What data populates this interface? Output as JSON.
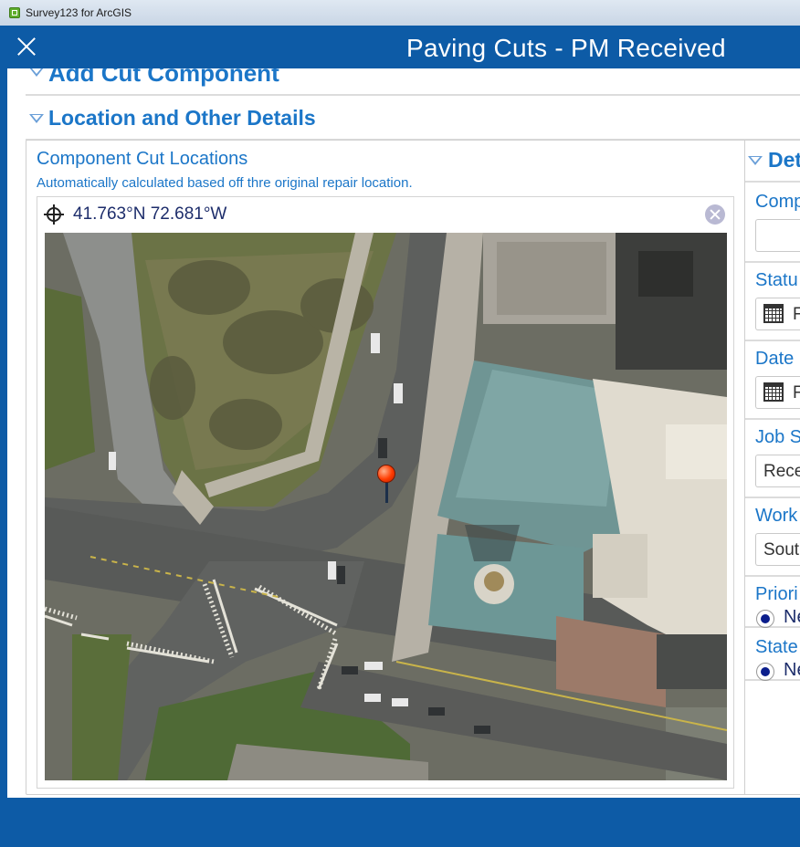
{
  "window": {
    "title": "Survey123 for ArcGIS"
  },
  "header": {
    "title": "Paving Cuts - PM Received"
  },
  "groups": {
    "add_cut": {
      "label": "Add Cut Component"
    },
    "location": {
      "label": "Location and Other Details"
    }
  },
  "location_card": {
    "title": "Component Cut Locations",
    "hint": "Automatically calculated based off thre original repair location.",
    "coordinates": "41.763°N 72.681°W"
  },
  "right_panel": {
    "group_label": "Det",
    "fields": [
      {
        "label": "Comp",
        "value": ""
      },
      {
        "label": "Statu",
        "value": "F"
      },
      {
        "label": "Date",
        "value": "F"
      },
      {
        "label": "Job S",
        "value": "Rece"
      },
      {
        "label": "Work",
        "value": "Sout"
      },
      {
        "label": "Priori",
        "value": "Ne"
      },
      {
        "label": "State",
        "value": "Ne"
      }
    ]
  },
  "icons": {
    "close": "close-icon",
    "collapse": "chevron-down-icon",
    "locate": "crosshair-icon",
    "clear": "clear-icon",
    "calendar": "calendar-icon",
    "marker": "map-pin-icon"
  },
  "colors": {
    "brand": "#0d5ba6",
    "label": "#1b76c8",
    "radio": "#0b1e8c"
  }
}
